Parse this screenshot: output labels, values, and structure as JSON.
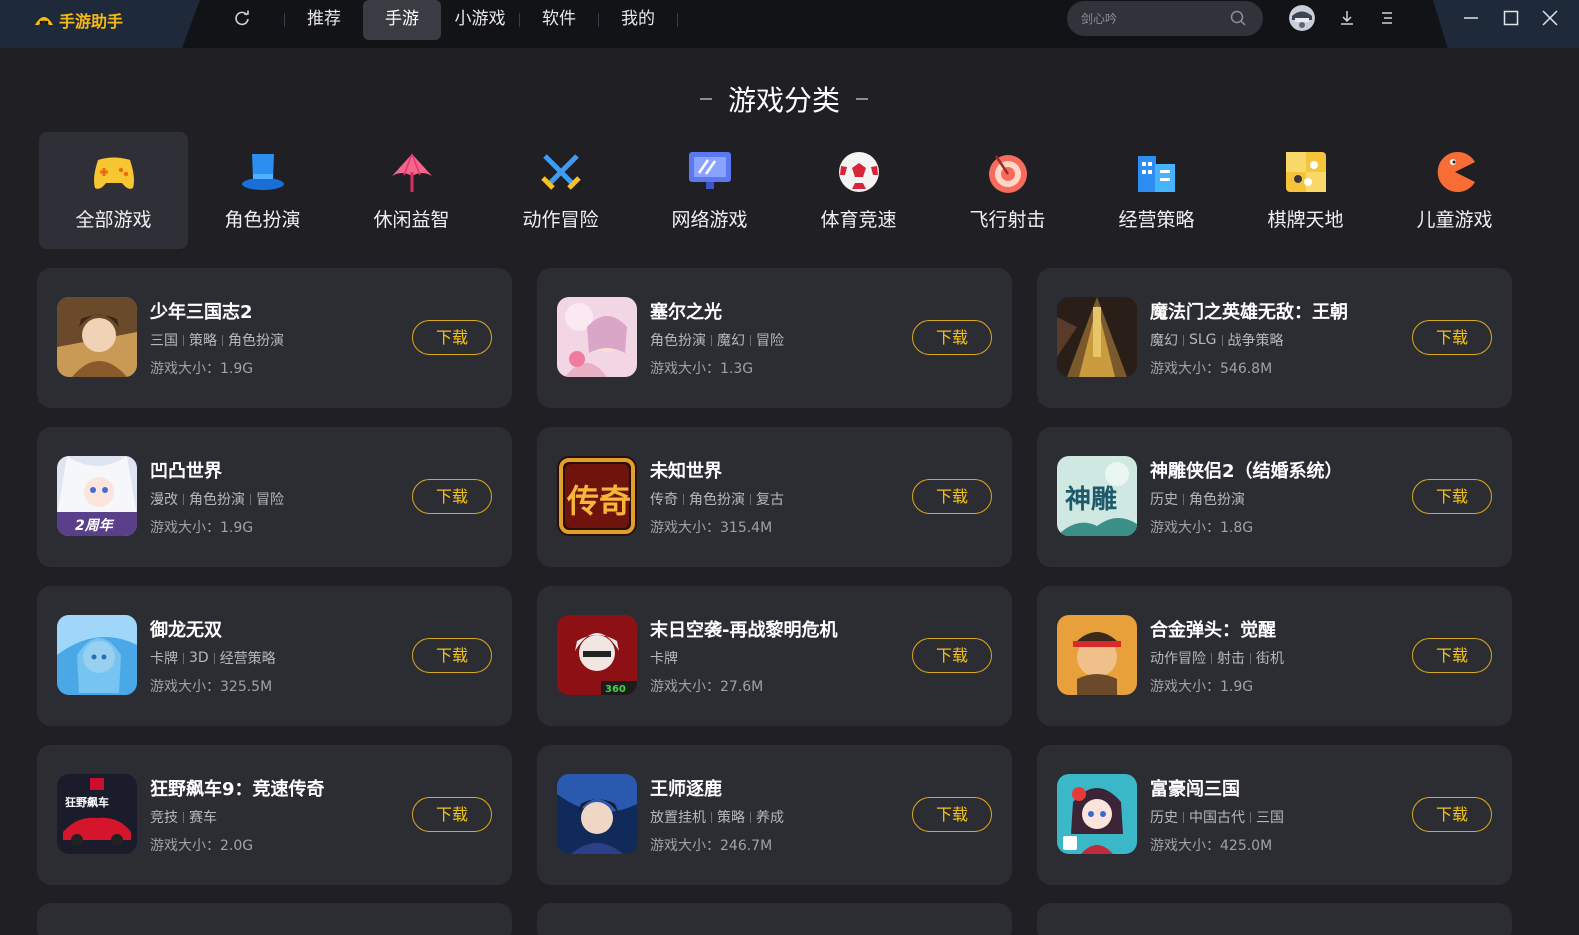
{
  "app": {
    "title": "手游助手",
    "brand_color": "#f6b913"
  },
  "nav": {
    "tabs": [
      {
        "label": "推荐",
        "active": false
      },
      {
        "label": "手游",
        "active": true
      },
      {
        "label": "小游戏",
        "active": false
      },
      {
        "label": "软件",
        "active": false
      },
      {
        "label": "我的",
        "active": false
      }
    ]
  },
  "search": {
    "placeholder": "剑心吟",
    "value": ""
  },
  "toolbar_icons": [
    "refresh-icon",
    "avatar",
    "download-icon",
    "menu-icon",
    "minimize-icon",
    "maximize-icon",
    "close-icon"
  ],
  "section_title": "游戏分类",
  "categories": [
    {
      "label": "全部游戏",
      "icon": "gamepad-icon",
      "active": true
    },
    {
      "label": "角色扮演",
      "icon": "top-hat-icon",
      "active": false
    },
    {
      "label": "休闲益智",
      "icon": "parasol-icon",
      "active": false
    },
    {
      "label": "动作冒险",
      "icon": "crossed-swords-icon",
      "active": false
    },
    {
      "label": "网络游戏",
      "icon": "monitor-icon",
      "active": false
    },
    {
      "label": "体育竞速",
      "icon": "soccer-ball-icon",
      "active": false
    },
    {
      "label": "飞行射击",
      "icon": "target-icon",
      "active": false
    },
    {
      "label": "经营策略",
      "icon": "buildings-icon",
      "active": false
    },
    {
      "label": "棋牌天地",
      "icon": "dice-board-icon",
      "active": false
    },
    {
      "label": "儿童游戏",
      "icon": "pacman-icon",
      "active": false
    }
  ],
  "download_label": "下载",
  "size_prefix": "游戏大小：",
  "games": [
    {
      "title": "少年三国志2",
      "tags": [
        "三国",
        "策略",
        "角色扮演"
      ],
      "size": "1.9G"
    },
    {
      "title": "塞尔之光",
      "tags": [
        "角色扮演",
        "魔幻",
        "冒险"
      ],
      "size": "1.3G"
    },
    {
      "title": "魔法门之英雄无敌：王朝",
      "tags": [
        "魔幻",
        "SLG",
        "战争策略"
      ],
      "size": "546.8M"
    },
    {
      "title": "凹凸世界",
      "tags": [
        "漫改",
        "角色扮演",
        "冒险"
      ],
      "size": "1.9G",
      "icon_text": "2周年"
    },
    {
      "title": "未知世界",
      "tags": [
        "传奇",
        "角色扮演",
        "复古"
      ],
      "size": "315.4M",
      "icon_text": "传奇"
    },
    {
      "title": "神雕侠侣2（结婚系统）",
      "tags": [
        "历史",
        "角色扮演"
      ],
      "size": "1.8G",
      "icon_text": "神雕"
    },
    {
      "title": "御龙无双",
      "tags": [
        "卡牌",
        "3D",
        "经营策略"
      ],
      "size": "325.5M"
    },
    {
      "title": "末日空袭-再战黎明危机",
      "tags": [
        "卡牌"
      ],
      "size": "27.6M",
      "icon_text": "360"
    },
    {
      "title": "合金弹头：觉醒",
      "tags": [
        "动作冒险",
        "射击",
        "街机"
      ],
      "size": "1.9G"
    },
    {
      "title": "狂野飙车9：竞速传奇",
      "tags": [
        "竞技",
        "赛车"
      ],
      "size": "2.0G",
      "icon_text": "狂野飙车"
    },
    {
      "title": "王师逐鹿",
      "tags": [
        "放置挂机",
        "策略",
        "养成"
      ],
      "size": "246.7M"
    },
    {
      "title": "富豪闯三国",
      "tags": [
        "历史",
        "中国古代",
        "三国"
      ],
      "size": "425.0M"
    }
  ]
}
